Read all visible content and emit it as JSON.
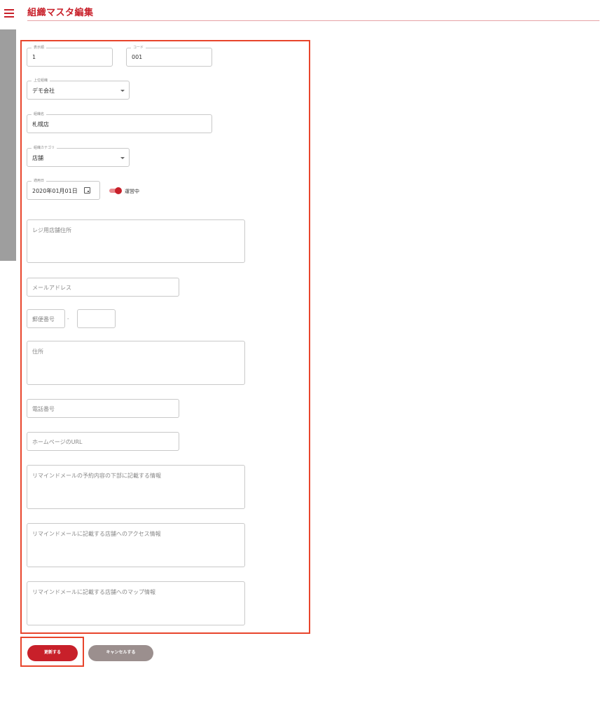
{
  "header": {
    "title": "組織マスタ編集"
  },
  "form": {
    "display_order": {
      "label": "表示順",
      "value": "1"
    },
    "code": {
      "label": "コード",
      "value": "001"
    },
    "parent_org": {
      "label": "上位組織",
      "value": "デモ会社"
    },
    "org_name": {
      "label": "組織名",
      "value": "札幌店"
    },
    "org_category": {
      "label": "組織カテゴリ",
      "value": "店舗"
    },
    "apply_date": {
      "label": "適用日",
      "value": "2020年01月01日"
    },
    "status_toggle": {
      "label": "運営中"
    },
    "register_address": {
      "placeholder": "レジ用店舗住所"
    },
    "email": {
      "placeholder": "メールアドレス"
    },
    "postal_code": {
      "placeholder": "郵便番号",
      "separator": "-"
    },
    "address": {
      "placeholder": "住所"
    },
    "phone": {
      "placeholder": "電話番号"
    },
    "homepage": {
      "placeholder": "ホームページのURL"
    },
    "reminder_footer": {
      "placeholder": "リマインドメールの予約内容の下部に記載する情報"
    },
    "reminder_access": {
      "placeholder": "リマインドメールに記載する店舗へのアクセス情報"
    },
    "reminder_map": {
      "placeholder": "リマインドメールに記載する店舗へのマップ情報"
    }
  },
  "buttons": {
    "update": "更新する",
    "cancel": "キャンセルする"
  },
  "colors": {
    "accent": "#c8202a",
    "highlight": "#e8452c",
    "cancel": "#9b8f8e"
  },
  "icons": {
    "menu": "menu-icon",
    "calendar": "calendar-icon",
    "dropdown": "chevron-down-icon"
  }
}
